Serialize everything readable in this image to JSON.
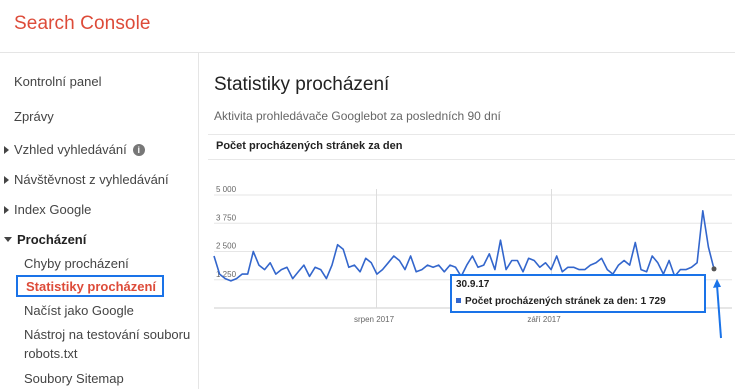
{
  "header": {
    "brand": "Search Console",
    "brand_color": "#dd4b39"
  },
  "sidebar": {
    "items": [
      {
        "label": "Kontrolní panel"
      },
      {
        "label": "Zprávy"
      },
      {
        "label": "Vzhled vyhledávání",
        "icon": "info-icon"
      },
      {
        "label": "Návštěvnost z vyhledávání"
      },
      {
        "label": "Index Google"
      },
      {
        "label": "Procházení"
      }
    ],
    "subitems": [
      {
        "label": "Chyby procházení"
      },
      {
        "label": "Statistiky procházení",
        "selected": true
      },
      {
        "label": "Načíst jako Google"
      },
      {
        "label": "Nástroj na testování souboru"
      },
      {
        "label": "robots.txt"
      },
      {
        "label": "Soubory Sitemap"
      }
    ]
  },
  "main": {
    "title": "Statistiky procházení",
    "subtitle": "Aktivita prohledávače Googlebot za posledních 90 dní",
    "section_label": "Počet procházených stránek za den"
  },
  "chart_data": {
    "type": "line",
    "title": "Počet procházených stránek za den",
    "xlabel": "",
    "ylabel": "",
    "ylim": [
      0,
      5000
    ],
    "y_ticks": [
      "5 000",
      "3 750",
      "2 500",
      "1 250"
    ],
    "x_ticks": [
      "srpen 2017",
      "září 2017"
    ],
    "series_color": "#3366cc",
    "series": [
      {
        "name": "Počet procházených stránek za den",
        "values": [
          2300,
          1500,
          1300,
          1200,
          1300,
          1500,
          1500,
          2500,
          1900,
          1700,
          2000,
          1500,
          1700,
          1800,
          1300,
          1600,
          1900,
          1400,
          1800,
          1700,
          1300,
          1900,
          2800,
          2600,
          1800,
          1900,
          1600,
          2200,
          2000,
          1500,
          1700,
          2000,
          2300,
          2100,
          1700,
          2300,
          1600,
          1700,
          1900,
          1800,
          1900,
          1600,
          1900,
          1800,
          1400,
          1900,
          2300,
          1800,
          1900,
          2400,
          1700,
          3000,
          1700,
          2100,
          2100,
          1600,
          2200,
          2100,
          1800,
          2000,
          1700,
          2300,
          1600,
          1800,
          1800,
          1700,
          1700,
          1900,
          2000,
          2200,
          1700,
          1500,
          1900,
          2100,
          1900,
          2900,
          1700,
          1600,
          2300,
          2000,
          1500,
          2100,
          1400,
          1700,
          1700,
          1800,
          2000,
          4300,
          2700,
          1729
        ]
      }
    ],
    "tooltip": {
      "date": "30.9.17",
      "series_label": "Počet procházených stránek za den: 1 729"
    }
  }
}
